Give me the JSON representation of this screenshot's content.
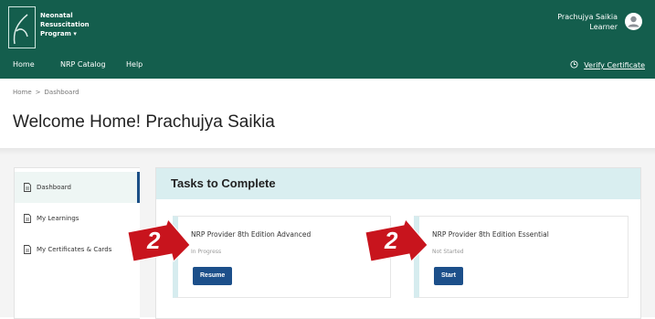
{
  "header": {
    "brand_lines": [
      "Neonatal",
      "Resuscitation",
      "Program"
    ],
    "brand_dropdown": "▾",
    "user_name": "Prachujya Saikia",
    "user_role": "Learner",
    "logo_icon": "nrp-logo-icon",
    "avatar_icon": "user-avatar-icon"
  },
  "nav": {
    "items": [
      "Home",
      "NRP Catalog",
      "Help"
    ],
    "verify_label": "Verify Certificate"
  },
  "breadcrumb": {
    "home": "Home",
    "separator": ">",
    "current": "Dashboard"
  },
  "page": {
    "welcome": "Welcome Home! Prachujya Saikia"
  },
  "sidebar": {
    "items": [
      {
        "label": "Dashboard",
        "icon": "document-icon",
        "active": true
      },
      {
        "label": "My Learnings",
        "icon": "document-icon",
        "active": false
      },
      {
        "label": "My Certificates & Cards",
        "icon": "document-icon",
        "active": false
      }
    ]
  },
  "tasks": {
    "title": "Tasks to Complete",
    "cards": [
      {
        "title": "NRP Provider 8th Edition Advanced",
        "status": "In Progress",
        "button": "Resume"
      },
      {
        "title": "NRP Provider 8th Edition Essential",
        "status": "Not Started",
        "button": "Start"
      }
    ]
  },
  "markers": [
    "2",
    "2"
  ],
  "colors": {
    "header_bg": "#145e4d",
    "primary_button": "#1c4f8a",
    "tasks_header_bg": "#d9eef0",
    "marker_red": "#c8141d"
  }
}
